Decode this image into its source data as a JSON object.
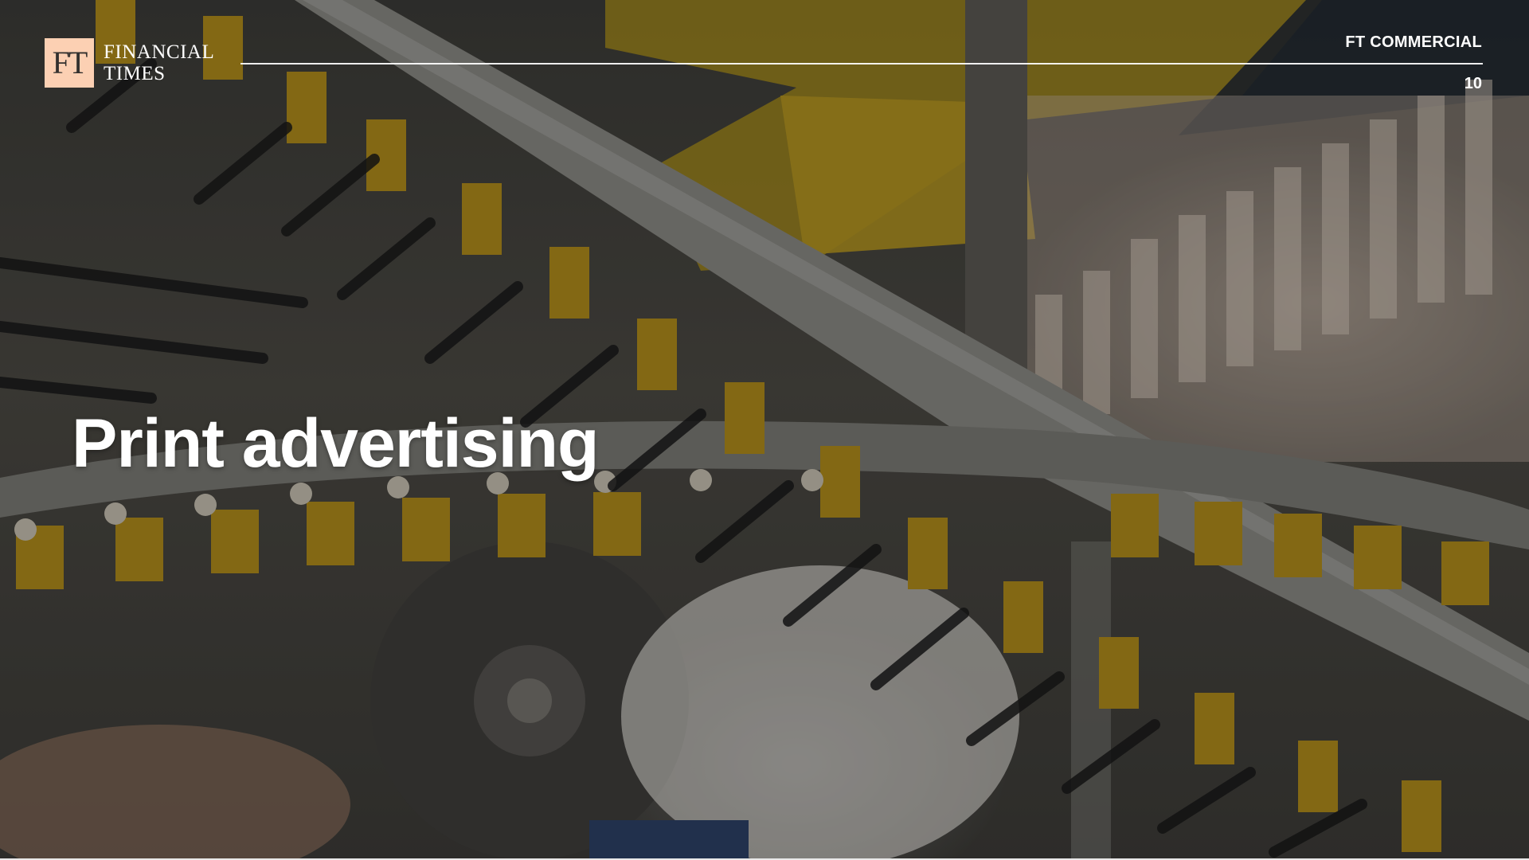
{
  "brand": {
    "logo_mark": "FT",
    "logo_line1": "FINANCIAL",
    "logo_line2": "TIMES"
  },
  "header": {
    "label": "FT COMMERCIAL",
    "page_number": "10"
  },
  "slide": {
    "title": "Print advertising"
  },
  "colors": {
    "logo_background": "#fcd0b3",
    "text": "#ffffff",
    "press_yellow": "#c9a21a"
  }
}
